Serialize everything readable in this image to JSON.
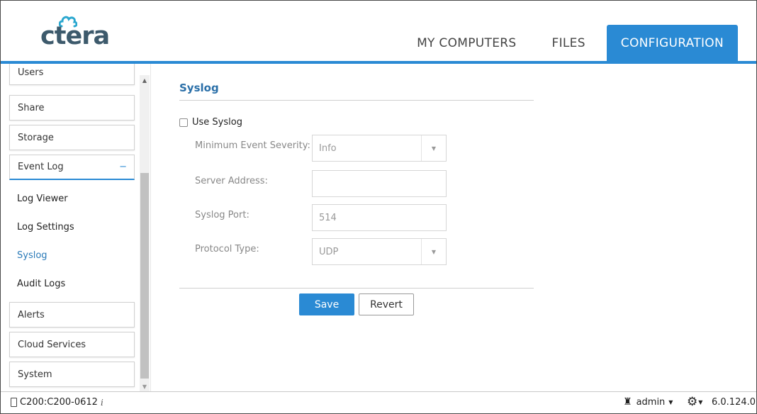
{
  "brand": {
    "logo_text": "ctera"
  },
  "tabs": [
    {
      "label": "MY COMPUTERS",
      "active": false
    },
    {
      "label": "FILES",
      "active": false
    },
    {
      "label": "CONFIGURATION",
      "active": true
    }
  ],
  "sidebar": {
    "items": [
      {
        "label": "Users"
      },
      {
        "label": "Share"
      },
      {
        "label": "Storage"
      },
      {
        "label": "Event Log",
        "expanded": true,
        "toggle": "−"
      },
      {
        "label": "Alerts"
      },
      {
        "label": "Cloud Services"
      },
      {
        "label": "System"
      }
    ],
    "subitems": [
      {
        "label": "Log Viewer"
      },
      {
        "label": "Log Settings"
      },
      {
        "label": "Syslog",
        "active": true
      },
      {
        "label": "Audit Logs"
      }
    ]
  },
  "page": {
    "title": "Syslog",
    "use_syslog_label": "Use Syslog",
    "use_syslog_checked": false,
    "fields": {
      "severity": {
        "label": "Minimum Event Severity:",
        "value": "Info"
      },
      "server": {
        "label": "Server Address:",
        "value": ""
      },
      "port": {
        "label": "Syslog Port:",
        "value": "514"
      },
      "protocol": {
        "label": "Protocol Type:",
        "value": "UDP"
      }
    },
    "save_label": "Save",
    "revert_label": "Revert"
  },
  "status": {
    "device": "C200:C200-0612",
    "info_glyph": "i",
    "user": "admin",
    "version": "6.0.124.0"
  },
  "colors": {
    "accent": "#2a8ad4",
    "title": "#2a6fa8"
  }
}
